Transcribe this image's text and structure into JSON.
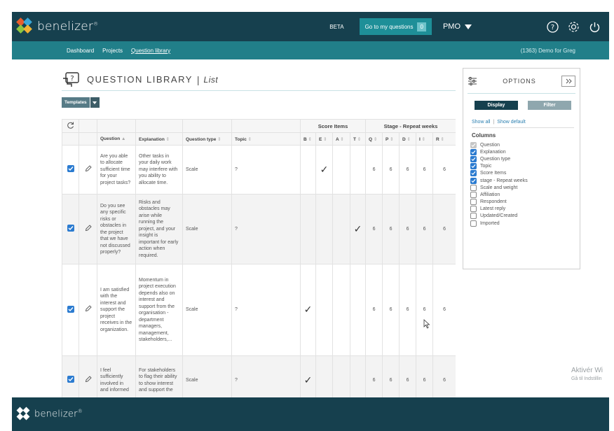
{
  "header": {
    "brand": "benelizer",
    "brand_mark": "®",
    "beta": "BETA",
    "goto_label": "Go to my questions",
    "goto_count": "0",
    "role": "PMO"
  },
  "nav": {
    "items": [
      "Dashboard",
      "Projects",
      "Question library"
    ],
    "account": "(1363)  Demo for Greg"
  },
  "page": {
    "title": "QUESTION LIBRARY",
    "subtitle": "List",
    "templates": "Templates"
  },
  "table": {
    "groups": {
      "score": "Score Items",
      "stage": "Stage - Repeat weeks"
    },
    "headers": {
      "question": "Question",
      "explanation": "Explanation",
      "qtype": "Question type",
      "topic": "Topic",
      "score_cols": [
        "B",
        "E",
        "A",
        "T"
      ],
      "stage_cols": [
        "Q",
        "P",
        "D",
        "I",
        "R"
      ]
    },
    "sort_up": "▲",
    "sort_both": "⇕",
    "rows": [
      {
        "question": "Are you able to allocate sufficient time for your project tasks?",
        "explanation": "Other tasks in your daily work may interfere with you ability to allocate time.",
        "qtype": "Scale",
        "topic": "?",
        "score": [
          "",
          "✓",
          "",
          ""
        ],
        "stage": [
          "6",
          "6",
          "6",
          "6",
          "6"
        ]
      },
      {
        "question": "Do you see any specific risks or obstacles in the project that we have not discussed properly?",
        "explanation": "Risks and obstacles may arise while running the project, and your insight is important for early action when required.",
        "qtype": "Scale",
        "topic": "?",
        "score": [
          "",
          "",
          "",
          "✓"
        ],
        "stage": [
          "6",
          "6",
          "6",
          "6",
          "6"
        ]
      },
      {
        "question": "I am satisfied with the interest and support the project receives in the organization.",
        "explanation": "Momentum in project execution depends also on interest and support from the organisation - department managers, management, stakeholders,...",
        "qtype": "Scale",
        "topic": "?",
        "score": [
          "✓",
          "",
          "",
          ""
        ],
        "stage": [
          "6",
          "6",
          "6",
          "6",
          "6"
        ]
      },
      {
        "question": "I feel sufficiently involved in and informed",
        "explanation": "For stakeholders to flag their ability to show interest and support the",
        "qtype": "Scale",
        "topic": "?",
        "score": [
          "✓",
          "",
          "",
          ""
        ],
        "stage": [
          "6",
          "6",
          "6",
          "6",
          "6"
        ]
      }
    ]
  },
  "options": {
    "title": "OPTIONS",
    "tab_display": "Display",
    "tab_filter": "Filter",
    "show_all": "Show all",
    "show_default": "Show default",
    "columns_title": "Columns",
    "columns": [
      {
        "label": "Question",
        "state": "disabled"
      },
      {
        "label": "Explanation",
        "state": "on"
      },
      {
        "label": "Question type",
        "state": "on"
      },
      {
        "label": "Topic",
        "state": "on"
      },
      {
        "label": "Score Items",
        "state": "on"
      },
      {
        "label": "stage - Repeat weeks",
        "state": "on"
      },
      {
        "label": "Scale and weight",
        "state": "off"
      },
      {
        "label": "Affiliation",
        "state": "off"
      },
      {
        "label": "Respondent",
        "state": "off"
      },
      {
        "label": "Latest reply",
        "state": "off"
      },
      {
        "label": "Updated/Created",
        "state": "off"
      },
      {
        "label": "Imported",
        "state": "off"
      }
    ]
  },
  "footer": {
    "brand": "benelizer",
    "brand_mark": "®"
  },
  "watermark": {
    "line1": "Aktivér Wi",
    "line2": "Gå til Indstillin"
  },
  "colors": {
    "header": "#16404e",
    "nav": "#217f89",
    "accent": "#1e8f98",
    "checkbox": "#2b7bd0"
  }
}
